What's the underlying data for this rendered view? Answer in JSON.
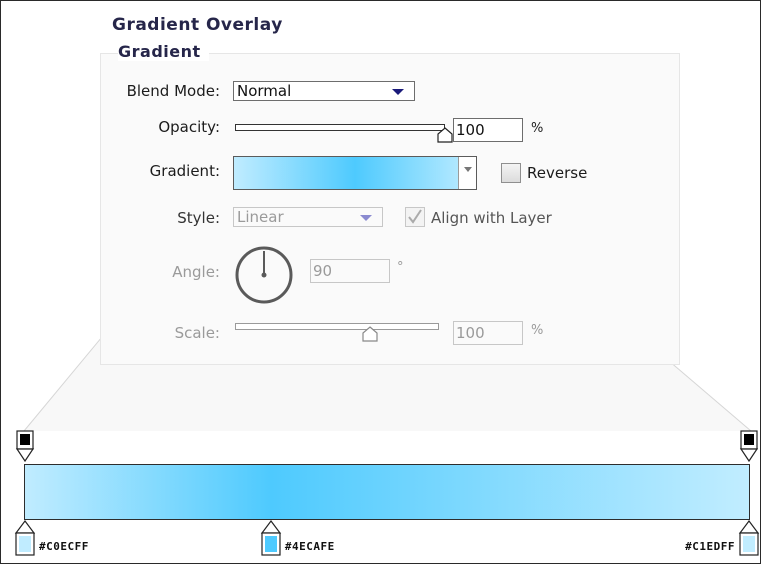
{
  "panel": {
    "title": "Gradient Overlay",
    "group_title": "Gradient"
  },
  "fields": {
    "blend_mode": {
      "label": "Blend Mode:",
      "value": "Normal"
    },
    "opacity": {
      "label": "Opacity:",
      "value": "100",
      "unit": "%",
      "level": 1.0
    },
    "gradient": {
      "label": "Gradient:",
      "reverse_label": "Reverse",
      "reverse_checked": false
    },
    "style": {
      "label": "Style:",
      "value": "Linear",
      "align_label": "Align with Layer",
      "align_checked": true
    },
    "angle": {
      "label": "Angle:",
      "value": "90",
      "unit": "°"
    },
    "scale": {
      "label": "Scale:",
      "value": "100",
      "unit": "%",
      "level": 0.66
    }
  },
  "gradient_editor": {
    "color_stops": [
      {
        "label": "#C0ECFF",
        "color": "#C0ECFF",
        "location": 0
      },
      {
        "label": "#4ECAFE",
        "color": "#4ECAFE",
        "location": 0.34
      },
      {
        "label": "#C1EDFF",
        "color": "#C1EDFF",
        "location": 1
      }
    ],
    "opacity_stops": [
      {
        "location": 0,
        "color": "#000000"
      },
      {
        "location": 1,
        "color": "#000000"
      }
    ]
  }
}
